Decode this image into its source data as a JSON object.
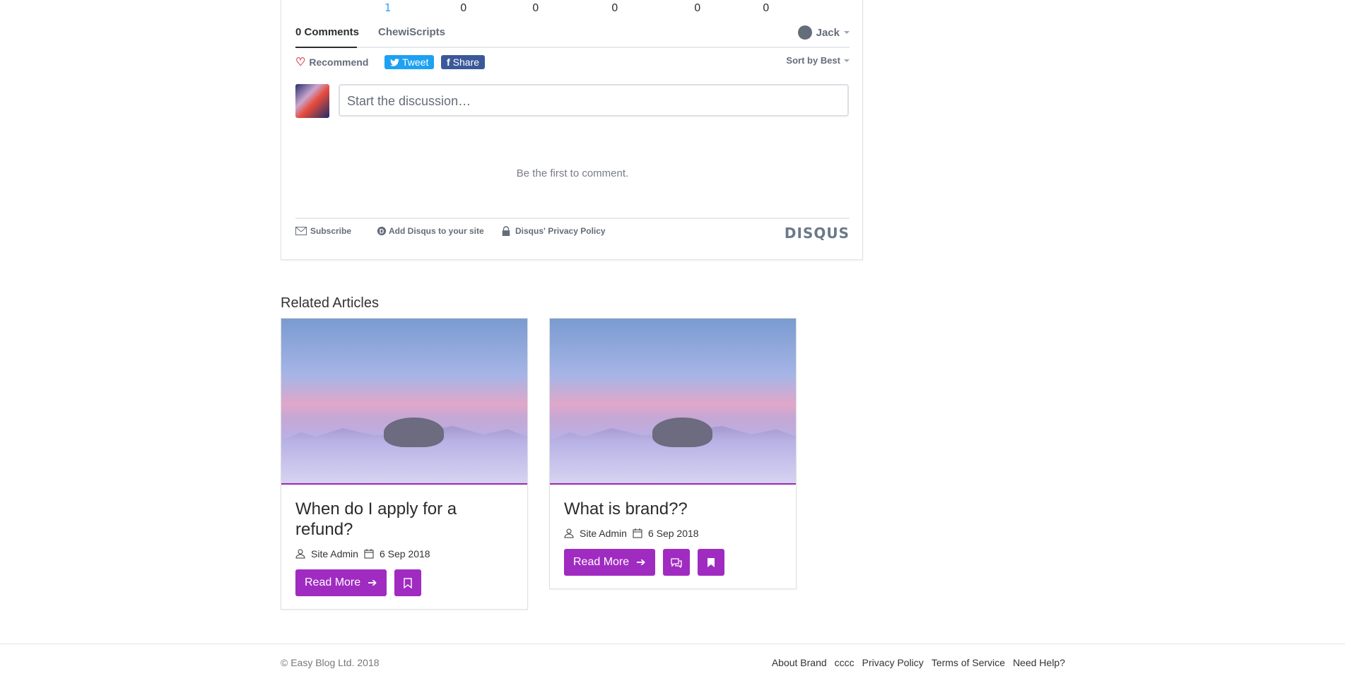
{
  "reactions": [
    "1",
    "0",
    "0",
    "0",
    "0",
    "0"
  ],
  "disqus": {
    "tabs": [
      "0 Comments",
      "ChewiScripts"
    ],
    "user": "Jack",
    "recommend": "Recommend",
    "tweet": "Tweet",
    "share": "Share",
    "sort": "Sort by Best",
    "placeholder": "Start the discussion…",
    "empty": "Be the first to comment.",
    "footer": {
      "subscribe": "Subscribe",
      "add": "Add Disqus to your site",
      "privacy": "Disqus' Privacy Policy",
      "logo": "DISQUS"
    }
  },
  "related": {
    "title": "Related Articles",
    "cards": [
      {
        "title": "When do I apply for a refund?",
        "author": "Site Admin",
        "date": "6 Sep 2018",
        "read": "Read More"
      },
      {
        "title": "What is brand??",
        "author": "Site Admin",
        "date": "6 Sep 2018",
        "read": "Read More"
      }
    ]
  },
  "footer": {
    "copyright": "© Easy Blog Ltd. 2018",
    "links": [
      "About Brand",
      "cccc",
      "Privacy Policy",
      "Terms of Service",
      "Need Help?"
    ]
  },
  "colors": {
    "accent": "#a02bc1",
    "twitter": "#1da1f2",
    "facebook": "#3b5999"
  }
}
